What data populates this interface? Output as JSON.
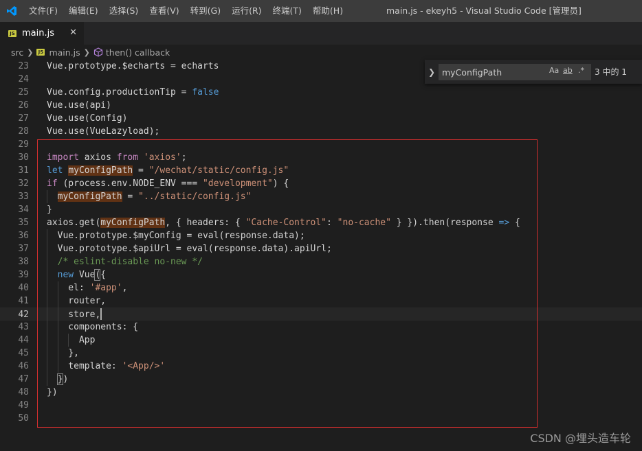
{
  "menu": [
    "文件(F)",
    "编辑(E)",
    "选择(S)",
    "查看(V)",
    "转到(G)",
    "运行(R)",
    "终端(T)",
    "帮助(H)"
  ],
  "window_title": "main.js - ekeyh5 - Visual Studio Code [管理员]",
  "tab": {
    "badge": "JS",
    "label": "main.js",
    "close": "✕"
  },
  "breadcrumb": {
    "folder": "src",
    "file": "main.js",
    "symbol": "then() callback",
    "file_badge": "JS"
  },
  "find": {
    "query": "myConfigPath",
    "match_case": "Aa",
    "whole_word": "ab",
    "regex": ".*",
    "result": "3 中的 1"
  },
  "lines": [
    {
      "n": "23",
      "tokens": [
        [
          "plain",
          "Vue.prototype.$echarts = echarts"
        ]
      ]
    },
    {
      "n": "24",
      "tokens": []
    },
    {
      "n": "25",
      "tokens": [
        [
          "plain",
          "Vue.config.productionTip = "
        ],
        [
          "kw",
          "false"
        ]
      ]
    },
    {
      "n": "26",
      "tokens": [
        [
          "plain",
          "Vue.use(api)"
        ]
      ]
    },
    {
      "n": "27",
      "tokens": [
        [
          "plain",
          "Vue.use(Config)"
        ]
      ]
    },
    {
      "n": "28",
      "tokens": [
        [
          "plain",
          "Vue.use(VueLazyload);"
        ]
      ]
    },
    {
      "n": "29",
      "tokens": []
    },
    {
      "n": "30",
      "tokens": [
        [
          "ctl",
          "import"
        ],
        [
          "plain",
          " axios "
        ],
        [
          "ctl",
          "from"
        ],
        [
          "plain",
          " "
        ],
        [
          "str",
          "'axios'"
        ],
        [
          "plain",
          ";"
        ]
      ]
    },
    {
      "n": "31",
      "tokens": [
        [
          "kw",
          "let"
        ],
        [
          "plain",
          " "
        ],
        [
          "match",
          "myConfigPath"
        ],
        [
          "plain",
          " = "
        ],
        [
          "str",
          "\"/wechat/static/config.js\""
        ]
      ]
    },
    {
      "n": "32",
      "tokens": [
        [
          "ctl",
          "if"
        ],
        [
          "plain",
          " (process.env.NODE_ENV === "
        ],
        [
          "str",
          "\"development\""
        ],
        [
          "plain",
          ") {"
        ]
      ]
    },
    {
      "n": "33",
      "tokens": [
        [
          "plain",
          "  "
        ],
        [
          "match",
          "myConfigPath"
        ],
        [
          "plain",
          " = "
        ],
        [
          "str",
          "\"../static/config.js\""
        ]
      ]
    },
    {
      "n": "34",
      "tokens": [
        [
          "plain",
          "}"
        ]
      ]
    },
    {
      "n": "35",
      "tokens": [
        [
          "plain",
          "axios.get("
        ],
        [
          "match",
          "myConfigPath"
        ],
        [
          "plain",
          ", { headers: { "
        ],
        [
          "str",
          "\"Cache-Control\""
        ],
        [
          "plain",
          ": "
        ],
        [
          "str",
          "\"no-cache\""
        ],
        [
          "plain",
          " } }).then(response "
        ],
        [
          "kw",
          "=>"
        ],
        [
          "plain",
          " {"
        ]
      ]
    },
    {
      "n": "36",
      "tokens": [
        [
          "plain",
          "  Vue.prototype.$myConfig = eval(response.data);"
        ]
      ]
    },
    {
      "n": "37",
      "tokens": [
        [
          "plain",
          "  Vue.prototype.$apiUrl = eval(response.data).apiUrl;"
        ]
      ]
    },
    {
      "n": "38",
      "tokens": [
        [
          "plain",
          "  "
        ],
        [
          "cmt",
          "/* eslint-disable no-new */"
        ]
      ]
    },
    {
      "n": "39",
      "tokens": [
        [
          "plain",
          "  "
        ],
        [
          "kw",
          "new"
        ],
        [
          "plain",
          " Vue({"
        ]
      ]
    },
    {
      "n": "40",
      "tokens": [
        [
          "plain",
          "    el: "
        ],
        [
          "str",
          "'#app'"
        ],
        [
          "plain",
          ","
        ]
      ]
    },
    {
      "n": "41",
      "tokens": [
        [
          "plain",
          "    router,"
        ]
      ]
    },
    {
      "n": "42",
      "tokens": [
        [
          "plain",
          "    store,"
        ]
      ]
    },
    {
      "n": "43",
      "tokens": [
        [
          "plain",
          "    components: {"
        ]
      ]
    },
    {
      "n": "44",
      "tokens": [
        [
          "plain",
          "      App"
        ]
      ]
    },
    {
      "n": "45",
      "tokens": [
        [
          "plain",
          "    },"
        ]
      ]
    },
    {
      "n": "46",
      "tokens": [
        [
          "plain",
          "    template: "
        ],
        [
          "str",
          "'<App/>'"
        ]
      ]
    },
    {
      "n": "47",
      "tokens": [
        [
          "plain",
          "  })"
        ]
      ]
    },
    {
      "n": "48",
      "tokens": [
        [
          "plain",
          "})"
        ]
      ]
    },
    {
      "n": "49",
      "tokens": []
    },
    {
      "n": "50",
      "tokens": []
    }
  ],
  "current_line": "42",
  "watermark": "CSDN @埋头造车轮",
  "colors": {
    "accent": "#007acc",
    "annotation_box": "#d32f2f",
    "find_match": "#613214"
  }
}
